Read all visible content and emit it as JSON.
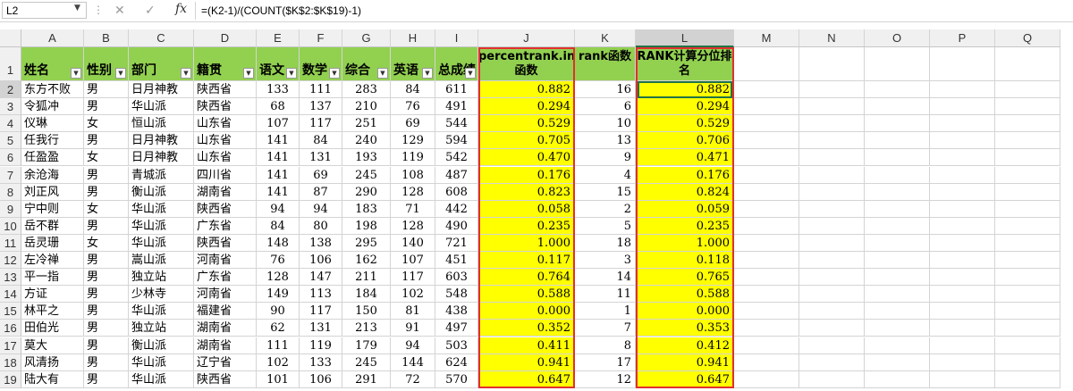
{
  "formula_bar": {
    "name_box": "L2",
    "cancel_icon": "✕",
    "enter_icon": "✓",
    "fx": "fx",
    "formula": "=(K2-1)/(COUNT($K$2:$K$19)-1)"
  },
  "columns": [
    "A",
    "B",
    "C",
    "D",
    "E",
    "F",
    "G",
    "H",
    "I",
    "J",
    "K",
    "L",
    "M",
    "N",
    "O",
    "P",
    "Q"
  ],
  "headers": [
    "姓名",
    "性别",
    "部门",
    "籍贯",
    "语文",
    "数学",
    "综合",
    "英语",
    "总成绩",
    "percentrank.inc函数",
    "rank函数",
    "RANK计算分位排名"
  ],
  "rows": [
    [
      "东方不败",
      "男",
      "日月神教",
      "陕西省",
      "133",
      "111",
      "283",
      "84",
      "611",
      "0.882",
      "16",
      "0.882"
    ],
    [
      "令狐冲",
      "男",
      "华山派",
      "陕西省",
      "68",
      "137",
      "210",
      "76",
      "491",
      "0.294",
      "6",
      "0.294"
    ],
    [
      "仪琳",
      "女",
      "恒山派",
      "山东省",
      "107",
      "117",
      "251",
      "69",
      "544",
      "0.529",
      "10",
      "0.529"
    ],
    [
      "任我行",
      "男",
      "日月神教",
      "山东省",
      "141",
      "84",
      "240",
      "129",
      "594",
      "0.705",
      "13",
      "0.706"
    ],
    [
      "任盈盈",
      "女",
      "日月神教",
      "山东省",
      "141",
      "131",
      "193",
      "119",
      "542",
      "0.470",
      "9",
      "0.471"
    ],
    [
      "余沧海",
      "男",
      "青城派",
      "四川省",
      "141",
      "69",
      "245",
      "108",
      "487",
      "0.176",
      "4",
      "0.176"
    ],
    [
      "刘正风",
      "男",
      "衡山派",
      "湖南省",
      "141",
      "87",
      "290",
      "128",
      "608",
      "0.823",
      "15",
      "0.824"
    ],
    [
      "宁中则",
      "女",
      "华山派",
      "陕西省",
      "94",
      "94",
      "183",
      "71",
      "442",
      "0.058",
      "2",
      "0.059"
    ],
    [
      "岳不群",
      "男",
      "华山派",
      "广东省",
      "84",
      "80",
      "198",
      "128",
      "490",
      "0.235",
      "5",
      "0.235"
    ],
    [
      "岳灵珊",
      "女",
      "华山派",
      "陕西省",
      "148",
      "138",
      "295",
      "140",
      "721",
      "1.000",
      "18",
      "1.000"
    ],
    [
      "左冷禅",
      "男",
      "嵩山派",
      "河南省",
      "76",
      "106",
      "162",
      "107",
      "451",
      "0.117",
      "3",
      "0.118"
    ],
    [
      "平一指",
      "男",
      "独立站",
      "广东省",
      "128",
      "147",
      "211",
      "117",
      "603",
      "0.764",
      "14",
      "0.765"
    ],
    [
      "方证",
      "男",
      "少林寺",
      "河南省",
      "149",
      "113",
      "184",
      "102",
      "548",
      "0.588",
      "11",
      "0.588"
    ],
    [
      "林平之",
      "男",
      "华山派",
      "福建省",
      "90",
      "117",
      "150",
      "81",
      "438",
      "0.000",
      "1",
      "0.000"
    ],
    [
      "田伯光",
      "男",
      "独立站",
      "湖南省",
      "62",
      "131",
      "213",
      "91",
      "497",
      "0.352",
      "7",
      "0.353"
    ],
    [
      "莫大",
      "男",
      "衡山派",
      "湖南省",
      "111",
      "119",
      "179",
      "94",
      "503",
      "0.411",
      "8",
      "0.412"
    ],
    [
      "风清扬",
      "男",
      "华山派",
      "辽宁省",
      "102",
      "133",
      "245",
      "144",
      "624",
      "0.941",
      "17",
      "0.941"
    ],
    [
      "陆大有",
      "男",
      "华山派",
      "陕西省",
      "101",
      "106",
      "291",
      "72",
      "570",
      "0.647",
      "12",
      "0.647"
    ]
  ],
  "colors": {
    "header_green": "#92d050",
    "highlight_yellow": "#ffff00",
    "outline_red": "#e03030",
    "selection_green": "#217346"
  }
}
